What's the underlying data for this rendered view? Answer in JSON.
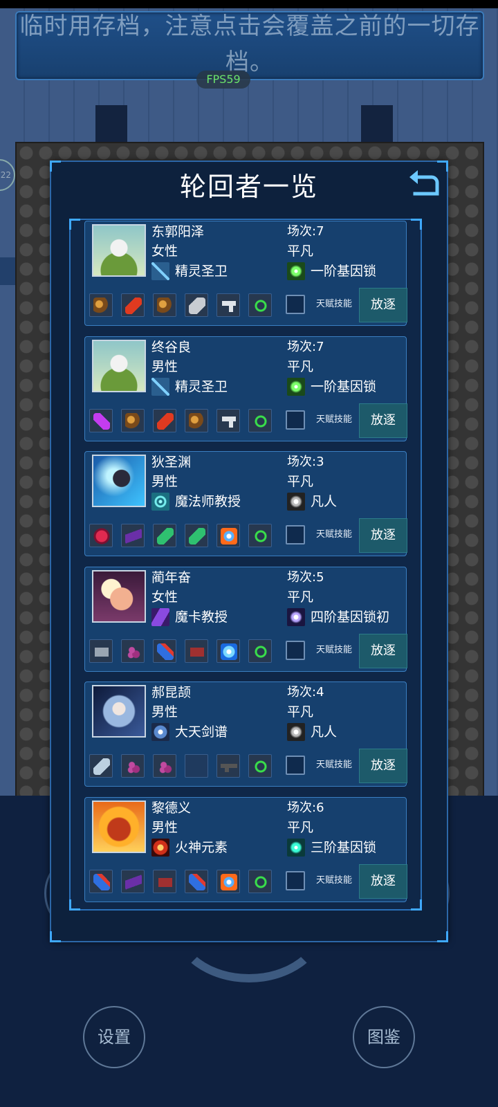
{
  "notice": "临时用存档，注意点击会覆盖之前的一切存档。",
  "fps": "FPS59",
  "modal_title": "轮回者一览",
  "talent_label": "天赋技能",
  "exile_label": "放逐",
  "bottom": {
    "settings": "设置",
    "codex": "图鉴"
  },
  "side_badge": "22",
  "characters": [
    {
      "name": "东郭阳泽",
      "gender": "女性",
      "class": "精灵圣卫",
      "round": "场次:7",
      "tier": "平凡",
      "rank": "一阶基因锁",
      "portrait": "elf-guard-portrait",
      "class_icon": "spear-icon",
      "rank_icon": "green-orb-icon",
      "items": [
        "ore-icon",
        "red-crystal-icon",
        "ore-icon",
        "silver-ore-icon",
        "pistol-icon",
        "green-rune-icon"
      ]
    },
    {
      "name": "终谷良",
      "gender": "男性",
      "class": "精灵圣卫",
      "round": "场次:7",
      "tier": "平凡",
      "rank": "一阶基因锁",
      "portrait": "elf-guard-portrait",
      "class_icon": "spear-icon",
      "rank_icon": "green-orb-icon",
      "items": [
        "purple-vial-icon",
        "ore-icon",
        "red-crystal-icon",
        "ore-icon",
        "pistol-icon",
        "green-rune-icon"
      ]
    },
    {
      "name": "狄圣渊",
      "gender": "男性",
      "class": "魔法师教授",
      "round": "场次:3",
      "tier": "平凡",
      "rank": "凡人",
      "portrait": "lightning-mage-portrait",
      "class_icon": "vortex-icon",
      "rank_icon": "white-orb-icon",
      "items": [
        "red-gem-icon",
        "purple-crystal-icon",
        "green-leaf-icon",
        "green-leaf-icon",
        "fire-orb-icon",
        "green-rune-icon"
      ]
    },
    {
      "name": "蔺年奋",
      "gender": "女性",
      "class": "魔卡教授",
      "round": "场次:5",
      "tier": "平凡",
      "rank": "四阶基因锁初",
      "portrait": "moon-girl-portrait",
      "class_icon": "purple-card-icon",
      "rank_icon": "violet-orb-icon",
      "items": [
        "grey-book-icon",
        "berry-cluster-icon",
        "blue-vial-icon",
        "red-book-icon",
        "ice-orb-icon",
        "green-rune-icon"
      ]
    },
    {
      "name": "郝昆颉",
      "gender": "男性",
      "class": "大天剑谱",
      "round": "场次:4",
      "tier": "平凡",
      "rank": "凡人",
      "portrait": "swordsman-portrait",
      "class_icon": "shuriken-icon",
      "rank_icon": "white-orb-icon",
      "items": [
        "silver-crystal-icon",
        "berry-cluster-icon",
        "berry-cluster-icon",
        "empty-slot",
        "rifle-icon",
        "green-rune-icon"
      ]
    },
    {
      "name": "黎德义",
      "gender": "男性",
      "class": "火神元素",
      "round": "场次:6",
      "tier": "平凡",
      "rank": "三阶基因锁",
      "portrait": "fire-spirit-portrait",
      "class_icon": "fire-skull-icon",
      "rank_icon": "cyan-orb-icon",
      "items": [
        "blue-vial-icon",
        "purple-crystal-icon",
        "red-book-icon",
        "blue-vial-icon",
        "fire-orb-icon",
        "green-rune-icon"
      ]
    }
  ]
}
